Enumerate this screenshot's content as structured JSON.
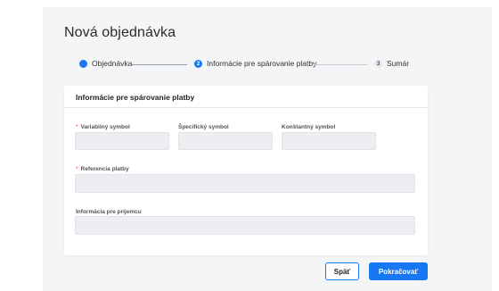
{
  "page": {
    "title": "Nová objednávka"
  },
  "stepper": {
    "steps": [
      {
        "label": "Objednávka",
        "number": "",
        "state": "done"
      },
      {
        "label": "Informácie pre spárovanie platby",
        "number": "2",
        "state": "active"
      },
      {
        "label": "Sumár",
        "number": "3",
        "state": "pending"
      }
    ]
  },
  "card": {
    "title": "Informácie pre spárovanie platby",
    "fields": {
      "variable_symbol": {
        "label": "Variabilný symbol",
        "required": true,
        "value": "",
        "placeholder": ""
      },
      "specific_symbol": {
        "label": "Špecifický symbol",
        "required": false,
        "value": "",
        "placeholder": ""
      },
      "constant_symbol": {
        "label": "Konštantný symbol",
        "required": false,
        "value": "",
        "placeholder": ""
      },
      "payment_reference": {
        "label": "Referencia platby",
        "required": true,
        "value": "",
        "placeholder": ""
      },
      "recipient_info": {
        "label": "Informácia pre prijemcu",
        "required": false,
        "value": "",
        "placeholder": ""
      }
    },
    "required_mark": "*"
  },
  "actions": {
    "back_label": "Späť",
    "continue_label": "Pokračovať"
  },
  "colors": {
    "accent": "#1877f2",
    "required": "#e0383e",
    "input_bg": "#eceef1",
    "panel_bg": "#f4f5f7"
  },
  "icons": {
    "step_done": "filled-circle-icon"
  }
}
